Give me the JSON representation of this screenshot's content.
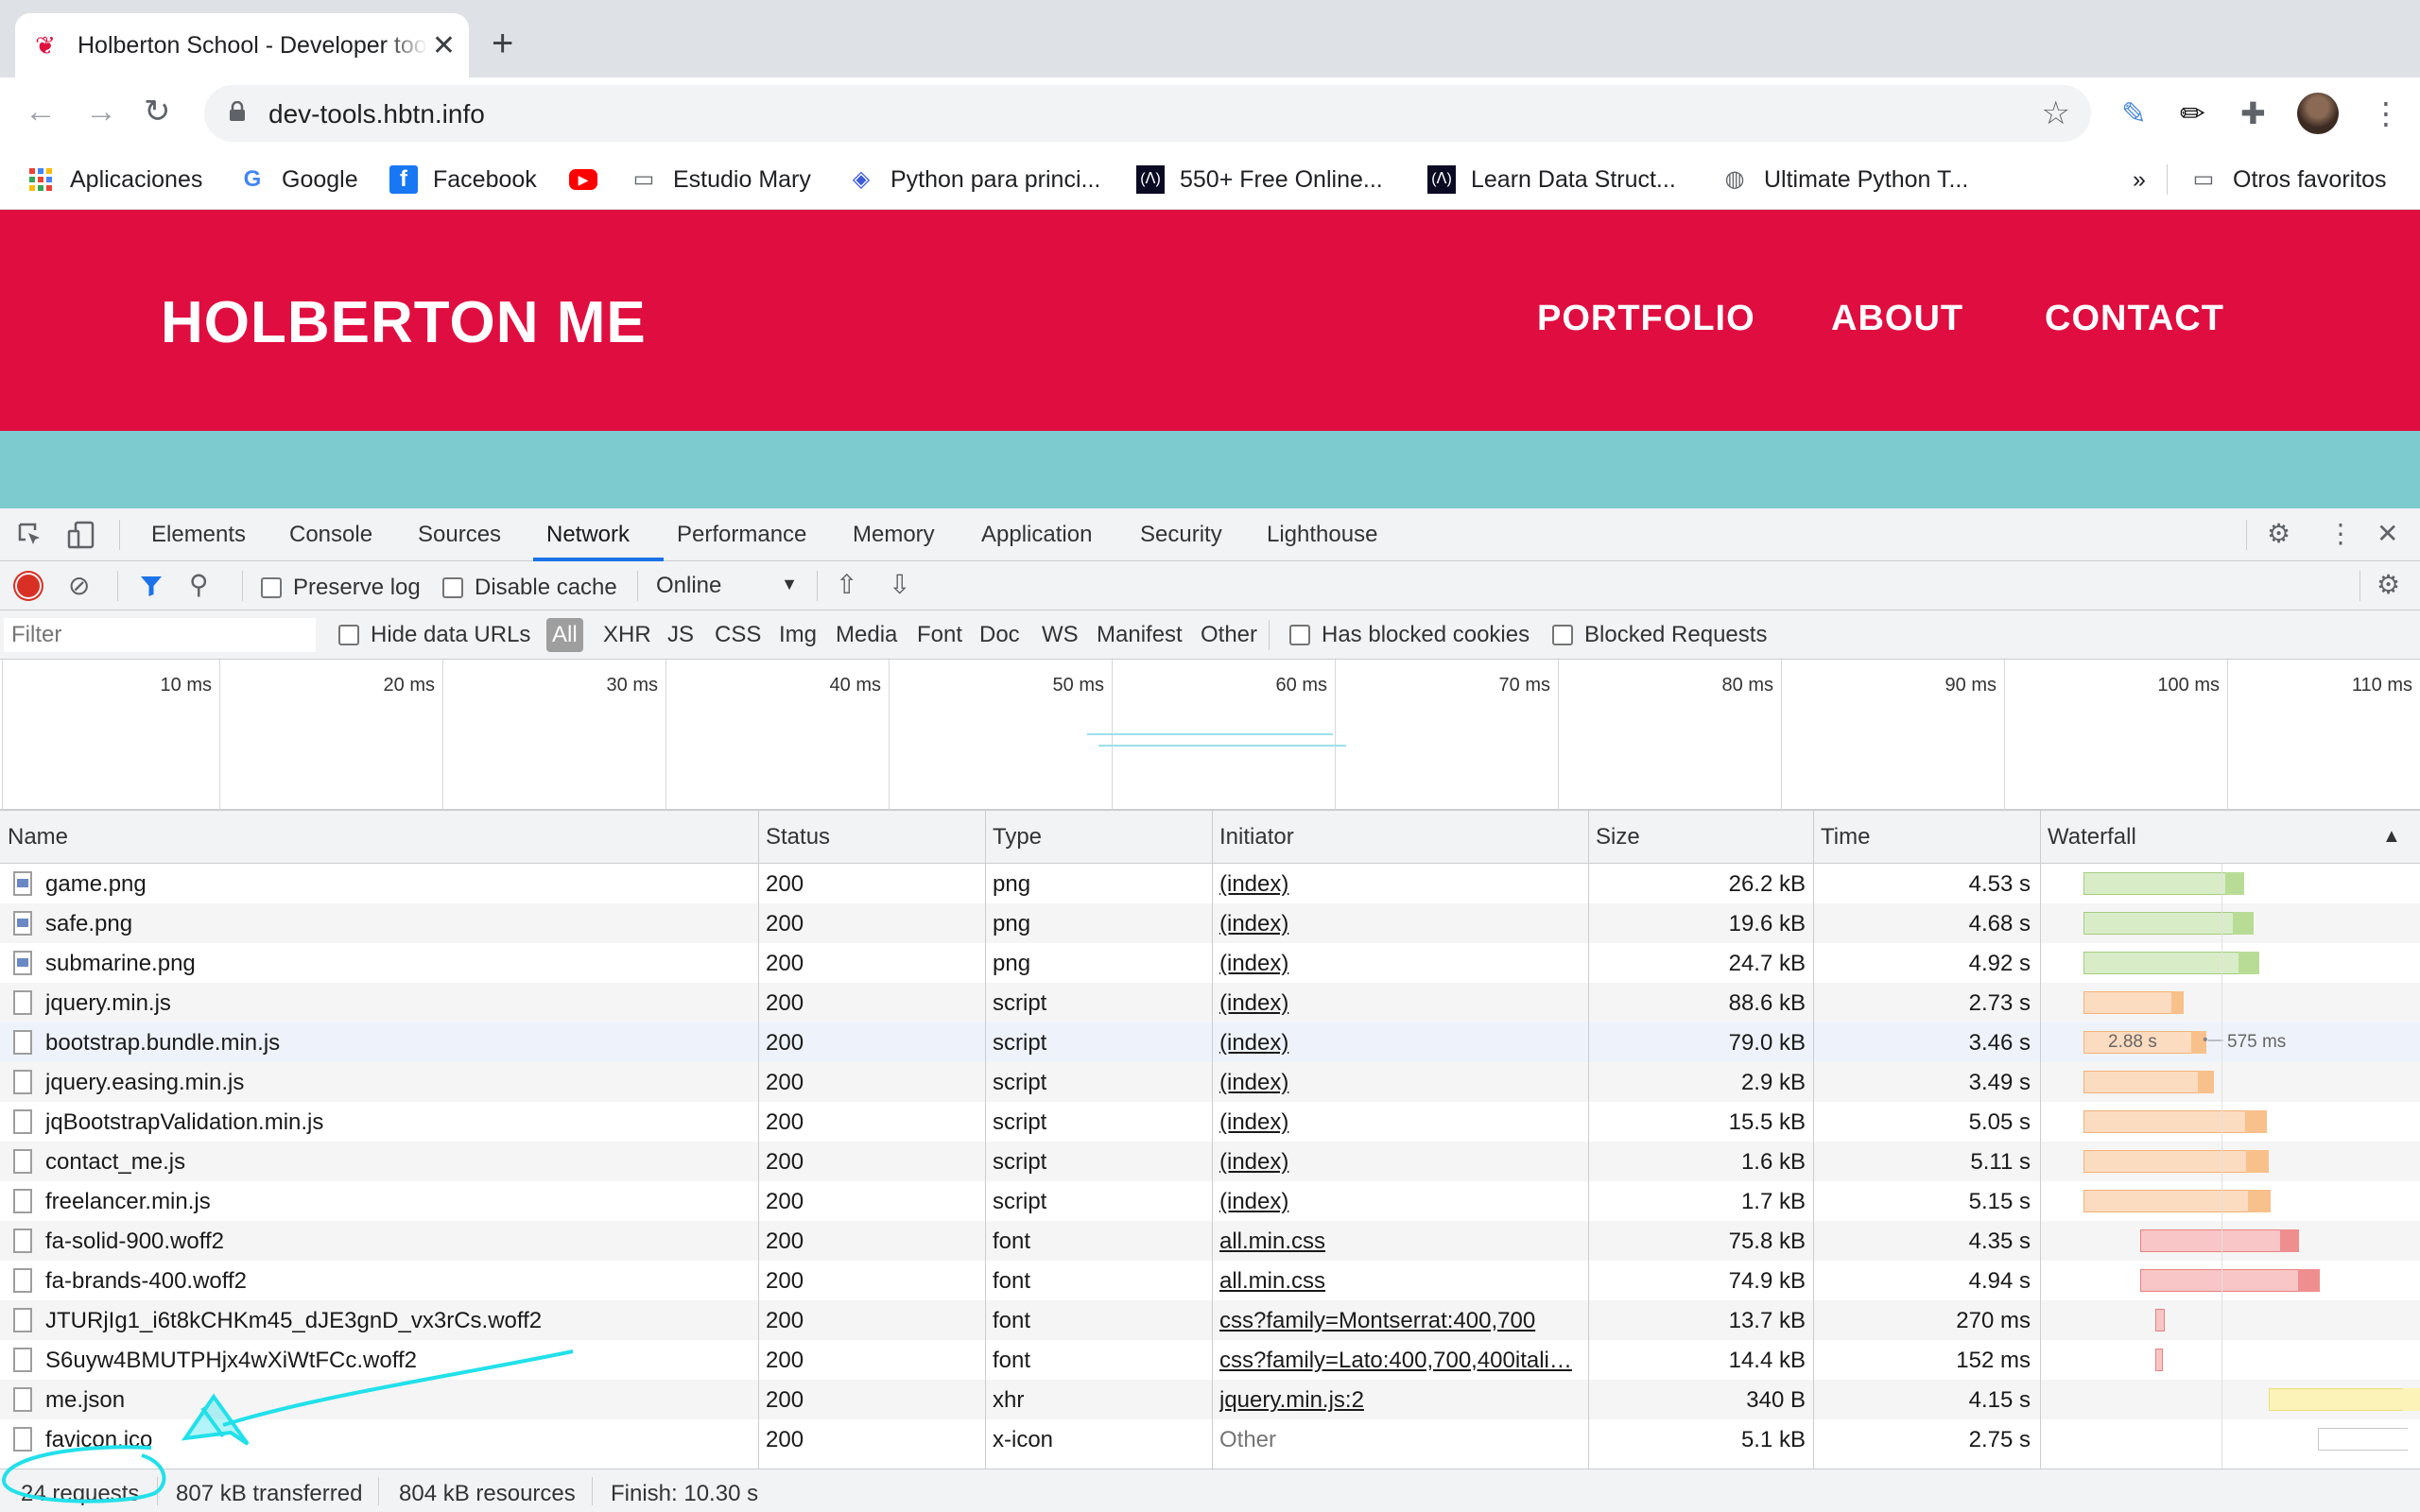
{
  "tab": {
    "title": "Holberton School - Developer tools",
    "close": "✕",
    "new": "+"
  },
  "omnibox": {
    "url": "dev-tools.hbtn.info"
  },
  "bookmarks": [
    {
      "label": "Aplicaciones",
      "icon": "apps-grid-icon"
    },
    {
      "label": "Google",
      "icon": "google-icon"
    },
    {
      "label": "Facebook",
      "icon": "facebook-icon"
    },
    {
      "label": "",
      "icon": "youtube-icon"
    },
    {
      "label": "Estudio Mary",
      "icon": "folder-icon"
    },
    {
      "label": "Python para princi...",
      "icon": "site-icon"
    },
    {
      "label": "550+ Free Online...",
      "icon": "freecodecamp-icon"
    },
    {
      "label": "Learn Data Struct...",
      "icon": "freecodecamp-icon"
    },
    {
      "label": "Ultimate Python T...",
      "icon": "globe-icon"
    }
  ],
  "bookmarks_more": "»",
  "bookmarks_other": "Otros favoritos",
  "page": {
    "brand": "HOLBERTON ME",
    "nav": [
      "PORTFOLIO",
      "ABOUT",
      "CONTACT"
    ],
    "colors": {
      "hero": "#e00d40",
      "band": "#7ecbcf"
    }
  },
  "devtools": {
    "tabs": [
      "Elements",
      "Console",
      "Sources",
      "Network",
      "Performance",
      "Memory",
      "Application",
      "Security",
      "Lighthouse"
    ],
    "active_tab": "Network",
    "toolbar": {
      "preserve_log": "Preserve log",
      "disable_cache": "Disable cache",
      "throttle": "Online"
    },
    "filter": {
      "placeholder": "Filter",
      "hide_data_urls": "Hide data URLs",
      "types": [
        "All",
        "XHR",
        "JS",
        "CSS",
        "Img",
        "Media",
        "Font",
        "Doc",
        "WS",
        "Manifest",
        "Other"
      ],
      "active_type": "All",
      "blocked_cookies": "Has blocked cookies",
      "blocked_requests": "Blocked Requests"
    },
    "overview_ticks": [
      "10 ms",
      "20 ms",
      "30 ms",
      "40 ms",
      "50 ms",
      "60 ms",
      "70 ms",
      "80 ms",
      "90 ms",
      "100 ms",
      "110 ms"
    ],
    "columns": [
      "Name",
      "Status",
      "Type",
      "Initiator",
      "Size",
      "Time",
      "Waterfall"
    ],
    "sort_indicator": "▲",
    "rows": [
      {
        "name": "game.png",
        "status": "200",
        "type": "png",
        "initiator": "(index)",
        "size": "26.2 kB",
        "time": "4.53 s",
        "kind": "img"
      },
      {
        "name": "safe.png",
        "status": "200",
        "type": "png",
        "initiator": "(index)",
        "size": "19.6 kB",
        "time": "4.68 s",
        "kind": "img"
      },
      {
        "name": "submarine.png",
        "status": "200",
        "type": "png",
        "initiator": "(index)",
        "size": "24.7 kB",
        "time": "4.92 s",
        "kind": "img"
      },
      {
        "name": "jquery.min.js",
        "status": "200",
        "type": "script",
        "initiator": "(index)",
        "size": "88.6 kB",
        "time": "2.73 s",
        "kind": "script"
      },
      {
        "name": "bootstrap.bundle.min.js",
        "status": "200",
        "type": "script",
        "initiator": "(index)",
        "size": "79.0 kB",
        "time": "3.46 s",
        "kind": "script",
        "wf_label_a": "2.88 s",
        "wf_label_b": "575 ms"
      },
      {
        "name": "jquery.easing.min.js",
        "status": "200",
        "type": "script",
        "initiator": "(index)",
        "size": "2.9 kB",
        "time": "3.49 s",
        "kind": "script"
      },
      {
        "name": "jqBootstrapValidation.min.js",
        "status": "200",
        "type": "script",
        "initiator": "(index)",
        "size": "15.5 kB",
        "time": "5.05 s",
        "kind": "script"
      },
      {
        "name": "contact_me.js",
        "status": "200",
        "type": "script",
        "initiator": "(index)",
        "size": "1.6 kB",
        "time": "5.11 s",
        "kind": "script"
      },
      {
        "name": "freelancer.min.js",
        "status": "200",
        "type": "script",
        "initiator": "(index)",
        "size": "1.7 kB",
        "time": "5.15 s",
        "kind": "script"
      },
      {
        "name": "fa-solid-900.woff2",
        "status": "200",
        "type": "font",
        "initiator": "all.min.css",
        "size": "75.8 kB",
        "time": "4.35 s",
        "kind": "font"
      },
      {
        "name": "fa-brands-400.woff2",
        "status": "200",
        "type": "font",
        "initiator": "all.min.css",
        "size": "74.9 kB",
        "time": "4.94 s",
        "kind": "font"
      },
      {
        "name": "JTURjIg1_i6t8kCHKm45_dJE3gnD_vx3rCs.woff2",
        "status": "200",
        "type": "font",
        "initiator": "css?family=Montserrat:400,700",
        "size": "13.7 kB",
        "time": "270 ms",
        "kind": "font"
      },
      {
        "name": "S6uyw4BMUTPHjx4wXiWtFCc.woff2",
        "status": "200",
        "type": "font",
        "initiator": "css?family=Lato:400,700,400itali…",
        "size": "14.4 kB",
        "time": "152 ms",
        "kind": "font"
      },
      {
        "name": "me.json",
        "status": "200",
        "type": "xhr",
        "initiator": "jquery.min.js:2",
        "size": "340 B",
        "time": "4.15 s",
        "kind": "xhr"
      },
      {
        "name": "favicon.ico",
        "status": "200",
        "type": "x-icon",
        "initiator": "Other",
        "size": "5.1 kB",
        "time": "2.75 s",
        "kind": "other"
      }
    ],
    "summary": {
      "requests": "24 requests",
      "transferred": "807 kB transferred",
      "resources": "804 kB resources",
      "finish": "Finish: 10.30 s"
    }
  }
}
